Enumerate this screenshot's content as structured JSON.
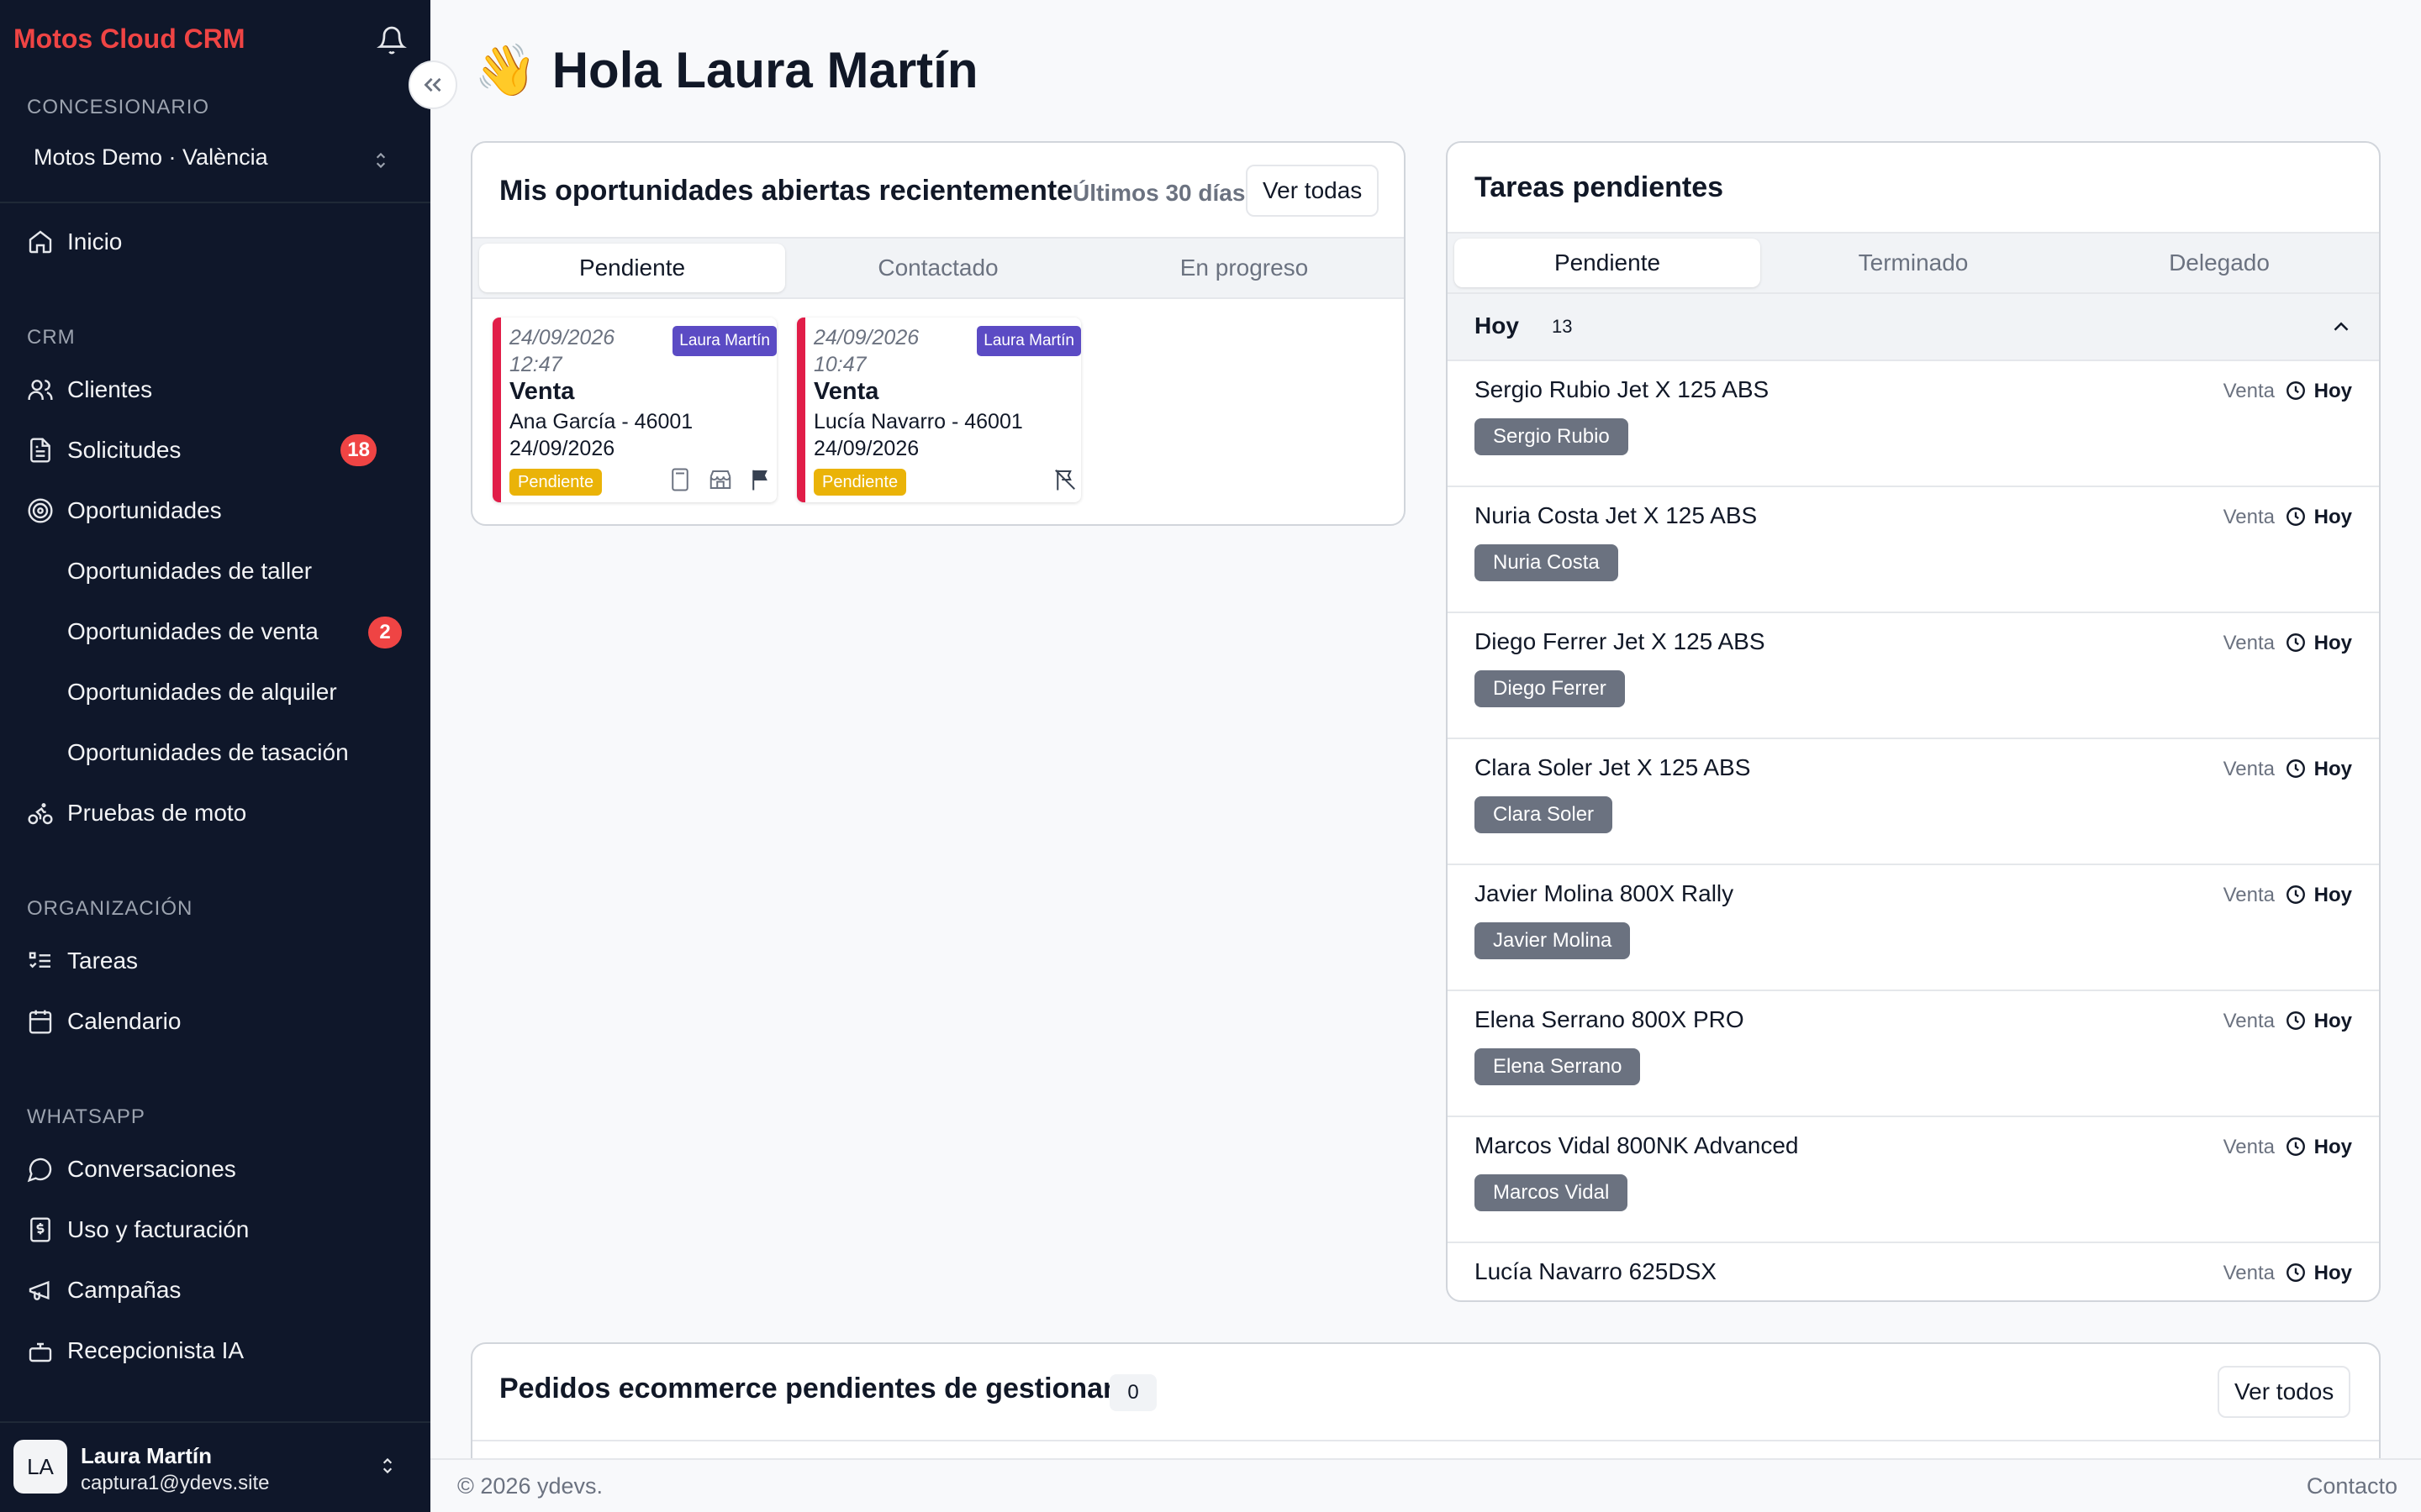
{
  "app": {
    "brand": "Motos Cloud CRM"
  },
  "sidebar": {
    "section_dealer": "CONCESIONARIO",
    "dealer": "Motos Demo · València",
    "home": "Inicio",
    "section_crm": "CRM",
    "clients": "Clientes",
    "requests": "Solicitudes",
    "requests_badge": "18",
    "opportunities": "Oportunidades",
    "opp_workshop": "Oportunidades de taller",
    "opp_sale": "Oportunidades de venta",
    "opp_sale_badge": "2",
    "opp_rental": "Oportunidades de alquiler",
    "opp_appraisal": "Oportunidades de tasación",
    "test_rides": "Pruebas de moto",
    "section_org": "ORGANIZACIÓN",
    "tasks": "Tareas",
    "calendar": "Calendario",
    "section_whatsapp": "WHATSAPP",
    "conversations": "Conversaciones",
    "billing": "Uso y facturación",
    "campaigns": "Campañas",
    "ai_receptionist": "Recepcionista IA",
    "user": {
      "initials": "LA",
      "name": "Laura Martín",
      "email": "captura1@ydevs.site"
    }
  },
  "main": {
    "greeting_emoji": "👋",
    "greeting": "Hola Laura Martín",
    "opps_card": {
      "title": "Mis oportunidades abiertas recientemente",
      "period": "Últimos 30 días",
      "view_all": "Ver todas",
      "tabs": [
        "Pendiente",
        "Contactado",
        "En progreso"
      ],
      "items": [
        {
          "datetime_date": "24/09/2026",
          "datetime_time": "12:47",
          "owner": "Laura Martín",
          "kind": "Venta",
          "client": "Ana García - 46001",
          "date": "24/09/2026",
          "status": "Pendiente"
        },
        {
          "datetime_date": "24/09/2026",
          "datetime_time": "10:47",
          "owner": "Laura Martín",
          "kind": "Venta",
          "client": "Lucía Navarro - 46001",
          "date": "24/09/2026",
          "status": "Pendiente"
        }
      ]
    },
    "tasks_card": {
      "title": "Tareas pendientes",
      "tabs": [
        "Pendiente",
        "Terminado",
        "Delegado"
      ],
      "group_label": "Hoy",
      "group_count": "13",
      "items": [
        {
          "title": "Sergio Rubio Jet X 125 ABS",
          "type": "Venta",
          "when": "Hoy",
          "chip": "Sergio Rubio"
        },
        {
          "title": "Nuria Costa Jet X 125 ABS",
          "type": "Venta",
          "when": "Hoy",
          "chip": "Nuria Costa"
        },
        {
          "title": "Diego Ferrer Jet X 125 ABS",
          "type": "Venta",
          "when": "Hoy",
          "chip": "Diego Ferrer"
        },
        {
          "title": "Clara Soler Jet X 125 ABS",
          "type": "Venta",
          "when": "Hoy",
          "chip": "Clara Soler"
        },
        {
          "title": "Javier Molina 800X Rally",
          "type": "Venta",
          "when": "Hoy",
          "chip": "Javier Molina"
        },
        {
          "title": "Elena Serrano 800X PRO",
          "type": "Venta",
          "when": "Hoy",
          "chip": "Elena Serrano"
        },
        {
          "title": "Marcos Vidal 800NK Advanced",
          "type": "Venta",
          "when": "Hoy",
          "chip": "Marcos Vidal"
        },
        {
          "title": "Lucía Navarro 625DSX",
          "type": "Venta",
          "when": "Hoy",
          "chip": ""
        }
      ]
    },
    "orders_card": {
      "title": "Pedidos ecommerce pendientes de gestionar",
      "count": "0",
      "view_all": "Ver todos"
    }
  },
  "footer": {
    "copyright": "© 2026 ydevs.",
    "contact": "Contacto"
  },
  "colors": {
    "sidebar_bg": "#0f172a",
    "brand": "#ef4444",
    "owner_badge": "#5b4bc4",
    "status_pending": "#eab308",
    "opp_accent": "#e11d48"
  }
}
